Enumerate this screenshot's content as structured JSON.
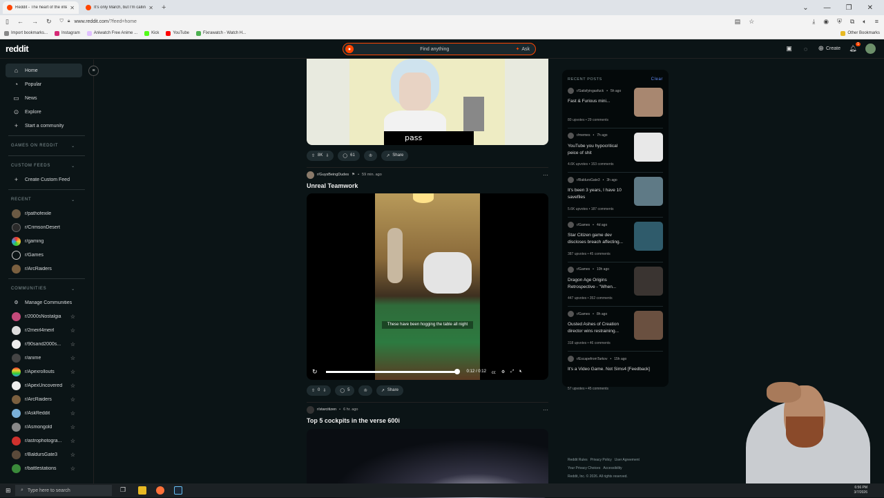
{
  "browser": {
    "tabs": [
      {
        "title": "Reddit - The heart of the intern",
        "active": true
      },
      {
        "title": "It's only March, but I'm calling i",
        "active": false
      }
    ],
    "url_domain": "www.reddit.com",
    "url_path": "/?feed=home",
    "bookmarks": [
      "Import bookmarks...",
      "Instagram",
      "Aniwatch Free Anime ...",
      "Kick",
      "YouTube",
      "Fixrawatch - Watch H..."
    ],
    "other_bookmarks": "Other Bookmarks"
  },
  "header": {
    "logo": "reddit",
    "search_placeholder": "Find anything",
    "ask_label": "Ask",
    "create_label": "Create",
    "notification_count": "1",
    "accent": "#ff4500"
  },
  "sidebar": {
    "nav": [
      {
        "label": "Home",
        "icon": "home-icon"
      },
      {
        "label": "Popular",
        "icon": "popular-icon"
      },
      {
        "label": "News",
        "icon": "news-icon"
      },
      {
        "label": "Explore",
        "icon": "explore-icon"
      },
      {
        "label": "Start a community",
        "icon": "plus-icon"
      }
    ],
    "games_heading": "GAMES ON REDDIT",
    "custom_feeds_heading": "CUSTOM FEEDS",
    "create_custom_feed": "Create Custom Feed",
    "recent_heading": "RECENT",
    "recent": [
      "r/pathofexile",
      "r/CrimsonDesert",
      "r/gaming",
      "r/Games",
      "r/ArcRaiders"
    ],
    "communities_heading": "COMMUNITIES",
    "manage_communities": "Manage Communities",
    "communities": [
      "r/2000sNostalgia",
      "r/2meirl4meirl",
      "r/90sand2000s...",
      "r/anime",
      "r/Apexrollouts",
      "r/ApexUncovered",
      "r/ArcRaiders",
      "r/AskReddit",
      "r/Asmongold",
      "r/astrophotogra...",
      "r/BaldursGate3",
      "r/battlestations"
    ]
  },
  "feed": {
    "post1": {
      "caption": "pass",
      "votes": "8K",
      "comments": "61",
      "share": "Share"
    },
    "post2": {
      "subreddit": "r/GuysBeingDudes",
      "time": "59 min. ago",
      "title": "Unreal Teamwork",
      "subtitle": "These have been hogging the table all night",
      "video_time": "0:12 / 0:12",
      "progress": 1.0,
      "votes": "0",
      "comments": "5",
      "share": "Share"
    },
    "post3": {
      "subreddit": "r/starcitizen",
      "time": "6 hr. ago",
      "title": "Top 5 cockpits in the verse 600i"
    }
  },
  "recent_posts": {
    "heading": "RECENT POSTS",
    "clear": "Clear",
    "items": [
      {
        "sub": "r/Satisfyingasfuck",
        "time": "5h ago",
        "title": "Fast & Furious mini...",
        "upvotes": "80 upvotes",
        "comments": "29 comments",
        "thumb_color": "#a88770"
      },
      {
        "sub": "r/memes",
        "time": "7h ago",
        "title": "YouTube you hypocritical peice of shit",
        "upvotes": "4.6K upvotes",
        "comments": "153 comments",
        "thumb_color": "#e8e8e8"
      },
      {
        "sub": "r/BaldursGate3",
        "time": "3h ago",
        "title": "It's been 3 years, I have 10 savefiles",
        "upvotes": "5.6K upvotes",
        "comments": "187 comments",
        "thumb_color": "#5f7a86"
      },
      {
        "sub": "r/Games",
        "time": "4d ago",
        "title": "Star Citizen game dev discloses breach affecting...",
        "upvotes": "387 upvotes",
        "comments": "45 comments",
        "thumb_color": "#2f5b6b"
      },
      {
        "sub": "r/Games",
        "time": "10h ago",
        "title": "Dragon Age Origins Retrospective - \"When...",
        "upvotes": "447 upvotes",
        "comments": "352 comments",
        "thumb_color": "#3a3431"
      },
      {
        "sub": "r/Games",
        "time": "8h ago",
        "title": "Ousted Ashes of Creation director wins restraining...",
        "upvotes": "318 upvotes",
        "comments": "46 comments",
        "thumb_color": "#6a5040"
      },
      {
        "sub": "r/EscapefromTarkov",
        "time": "15h ago",
        "title": "It's a Video Game. Not Sims4 [Feedback]",
        "upvotes": "57 upvotes",
        "comments": "45 comments",
        "thumb_color": ""
      }
    ]
  },
  "footer": {
    "links": [
      "Reddit Rules",
      "Privacy Policy",
      "User Agreement",
      "Your Privacy Choices",
      "Accessibility"
    ],
    "copyright": "Reddit, Inc. © 2026. All rights reserved."
  },
  "taskbar": {
    "search_placeholder": "Type here to search",
    "time": "6:56 PM",
    "date": "3/7/2026"
  }
}
